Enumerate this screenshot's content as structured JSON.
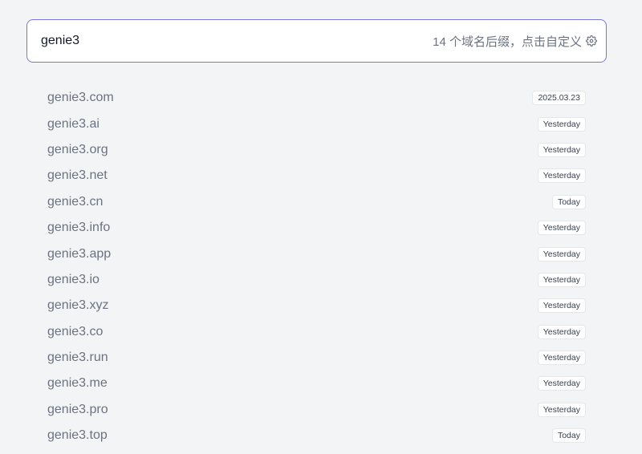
{
  "search": {
    "value": "genie3",
    "suffix_info": "14 个域名后缀，点击自定义"
  },
  "domains": [
    {
      "name": "genie3.com",
      "date": "2025.03.23"
    },
    {
      "name": "genie3.ai",
      "date": "Yesterday"
    },
    {
      "name": "genie3.org",
      "date": "Yesterday"
    },
    {
      "name": "genie3.net",
      "date": "Yesterday"
    },
    {
      "name": "genie3.cn",
      "date": "Today"
    },
    {
      "name": "genie3.info",
      "date": "Yesterday"
    },
    {
      "name": "genie3.app",
      "date": "Yesterday"
    },
    {
      "name": "genie3.io",
      "date": "Yesterday"
    },
    {
      "name": "genie3.xyz",
      "date": "Yesterday"
    },
    {
      "name": "genie3.co",
      "date": "Yesterday"
    },
    {
      "name": "genie3.run",
      "date": "Yesterday"
    },
    {
      "name": "genie3.me",
      "date": "Yesterday"
    },
    {
      "name": "genie3.pro",
      "date": "Yesterday"
    },
    {
      "name": "genie3.top",
      "date": "Today"
    }
  ],
  "colors": {
    "accent_border": "#7c74d6",
    "background": "#f3f4f6"
  },
  "icons": {
    "settings": "gear-icon"
  }
}
